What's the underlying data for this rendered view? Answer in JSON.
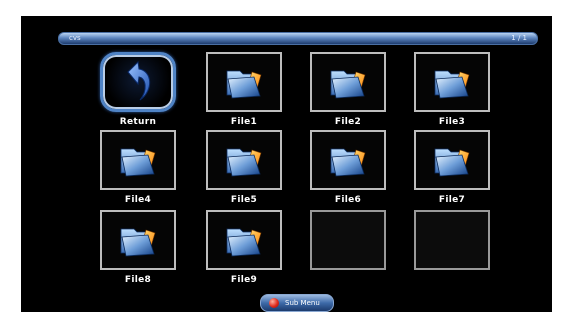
{
  "header": {
    "path_label": "cvs",
    "page_counter": "1 / 1"
  },
  "items": [
    {
      "label": "Return",
      "icon": "return-arrow-icon"
    },
    {
      "label": "File1",
      "icon": "folder-icon"
    },
    {
      "label": "File2",
      "icon": "folder-icon"
    },
    {
      "label": "File3",
      "icon": "folder-icon"
    },
    {
      "label": "File4",
      "icon": "folder-icon"
    },
    {
      "label": "File5",
      "icon": "folder-icon"
    },
    {
      "label": "File6",
      "icon": "folder-icon"
    },
    {
      "label": "File7",
      "icon": "folder-icon"
    },
    {
      "label": "File8",
      "icon": "folder-icon"
    },
    {
      "label": "File9",
      "icon": "folder-icon"
    }
  ],
  "footer": {
    "submenu_label": "Sub Menu",
    "submenu_icon": "red-button-icon"
  },
  "colors": {
    "selection_border": "#4f83c5",
    "tile_border": "#bdbdbd",
    "background": "#000000"
  }
}
